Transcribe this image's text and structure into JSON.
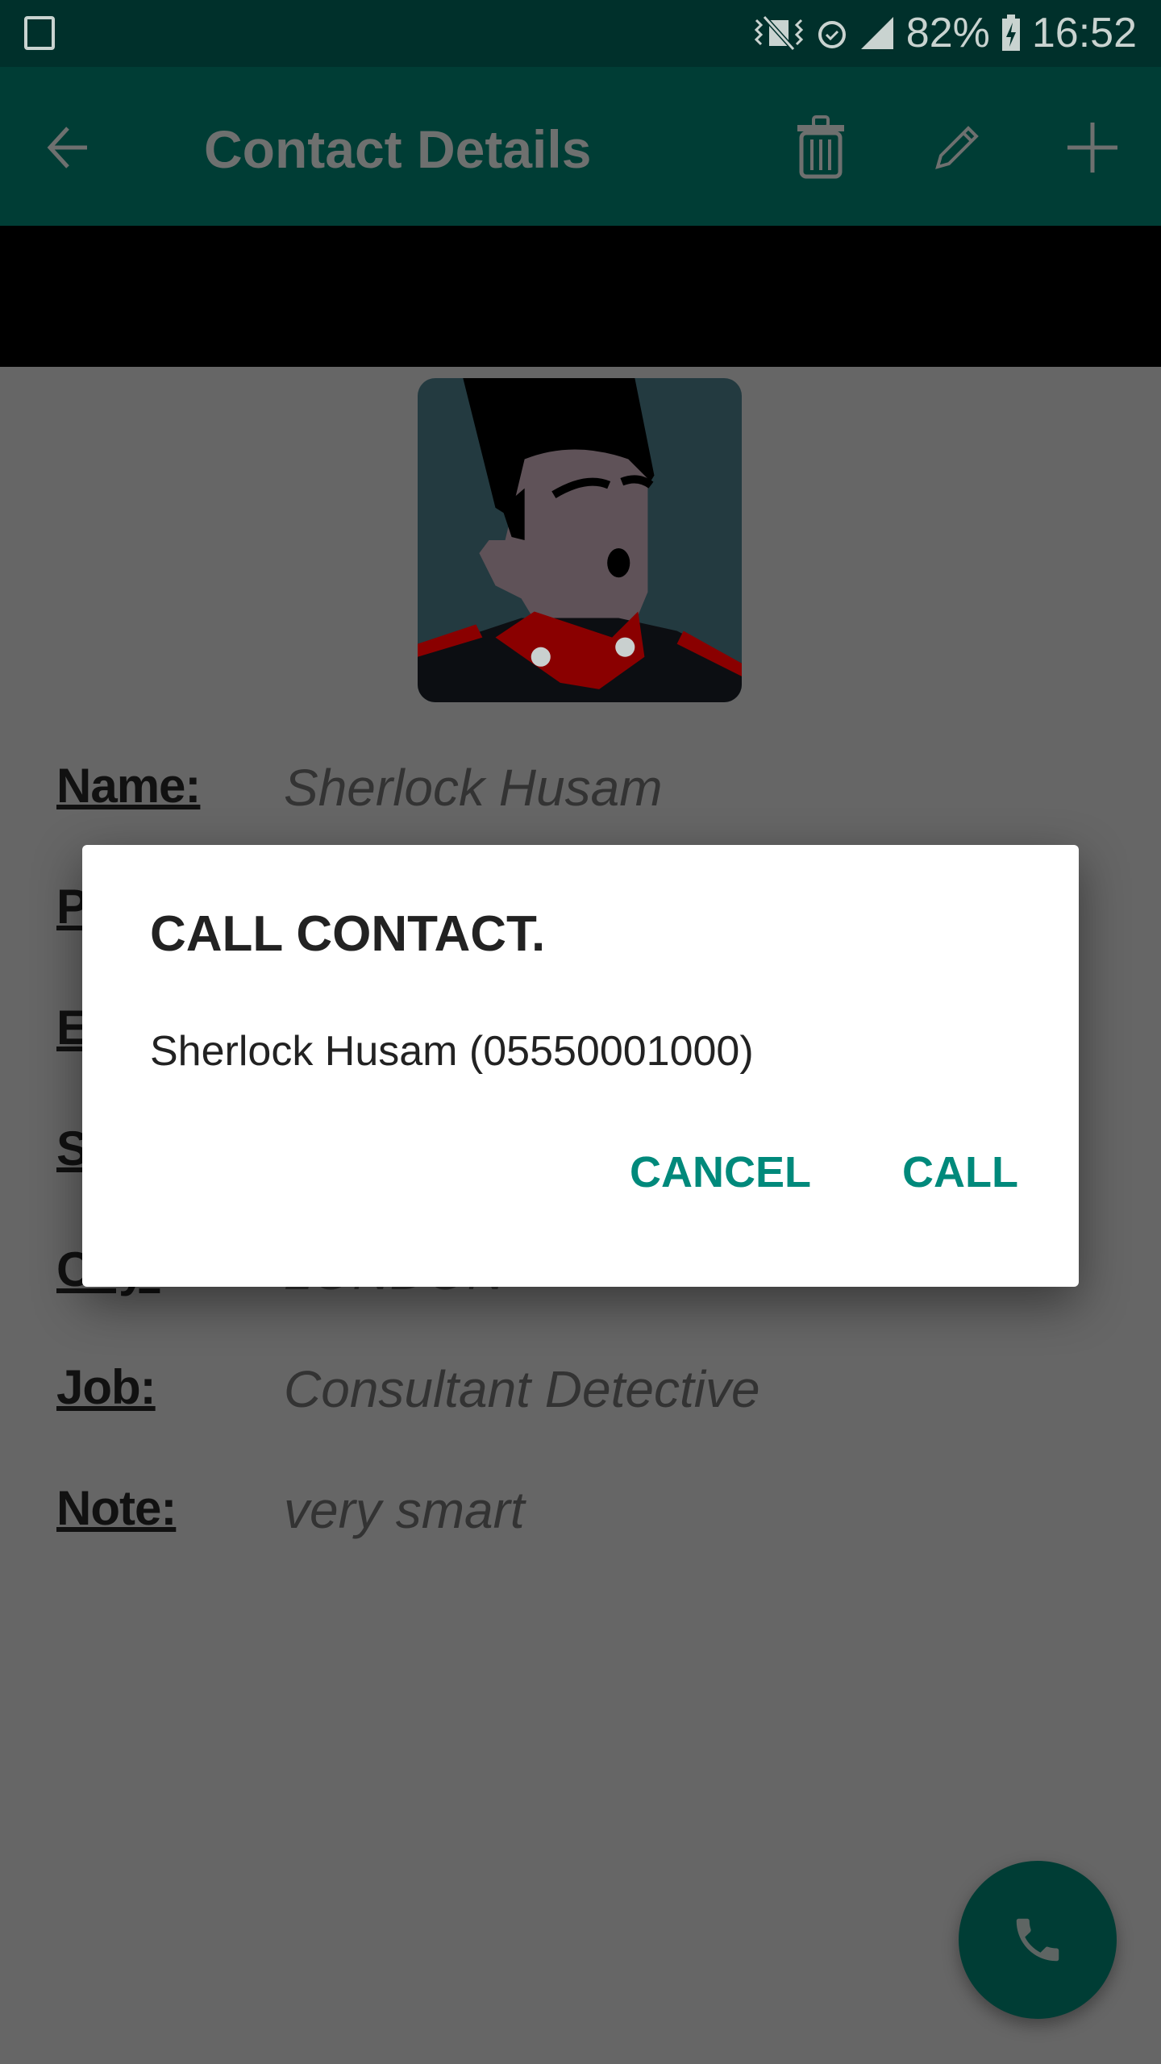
{
  "status_bar": {
    "battery": "82%",
    "time": "16:52",
    "icons": [
      "gallery-icon",
      "vibrate-mute-icon",
      "alarm-icon",
      "signal-icon",
      "battery-charging-icon"
    ]
  },
  "toolbar": {
    "title": "Contact Details",
    "icons": [
      "back-arrow-icon",
      "trash-icon",
      "pencil-icon",
      "plus-icon"
    ]
  },
  "contact": {
    "rows": [
      {
        "label": "Name:",
        "value": "Sherlock Husam"
      },
      {
        "label": "Phone:",
        "value": "05550001000"
      },
      {
        "label": "Email:",
        "value": ""
      },
      {
        "label": "Street:",
        "value": ""
      },
      {
        "label": "City:",
        "value": "LONDON"
      },
      {
        "label": "Job:",
        "value": "Consultant Detective"
      },
      {
        "label": "Note:",
        "value": "very smart"
      }
    ]
  },
  "dialog": {
    "title": "CALL CONTACT.",
    "message": "Sherlock Husam  (05550001000)",
    "cancel": "CANCEL",
    "call": "CALL"
  },
  "fab": {
    "icon": "phone-icon"
  },
  "colors": {
    "toolbar": "#003d35",
    "status_bar": "#00302b",
    "accent": "#00897b",
    "scrim": "#666666"
  }
}
